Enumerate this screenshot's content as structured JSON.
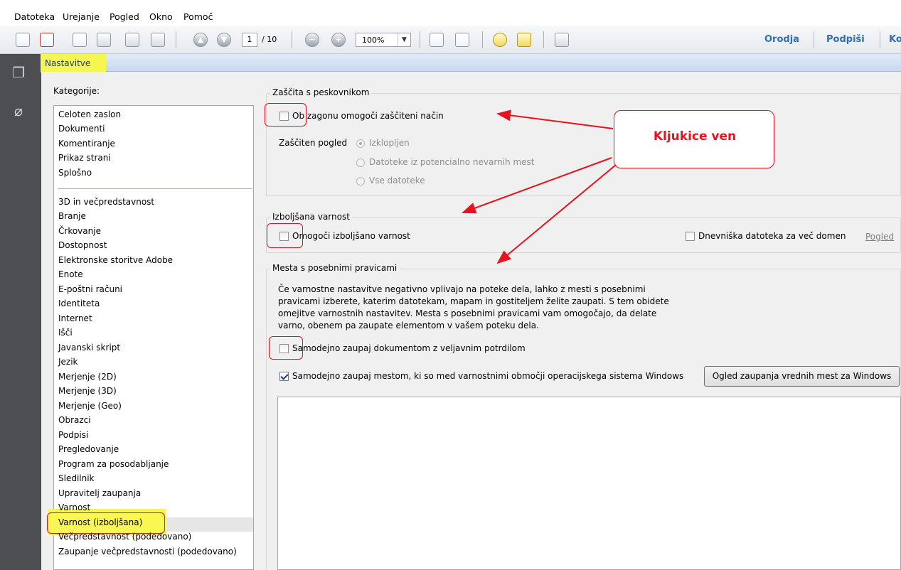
{
  "menu": [
    "Datoteka",
    "Urejanje",
    "Pogled",
    "Okno",
    "Pomoč"
  ],
  "toolbar": {
    "page_current": "1",
    "page_total": "/ 10",
    "zoom": "100%",
    "tools": "Orodja",
    "sign": "Podpiši",
    "comment_partial": "Ko"
  },
  "dialog": {
    "title": "Nastavitve",
    "categories_label": "Kategorije:",
    "categories_top": [
      "Celoten zaslon",
      "Dokumenti",
      "Komentiranje",
      "Prikaz strani",
      "Splošno"
    ],
    "categories": [
      "3D in večpredstavnost",
      "Branje",
      "Črkovanje",
      "Dostopnost",
      "Elektronske storitve Adobe",
      "Enote",
      "E-poštni računi",
      "Identiteta",
      "Internet",
      "Išči",
      "Javanski skript",
      "Jezik",
      "Merjenje (2D)",
      "Merjenje (3D)",
      "Merjenje (Geo)",
      "Obrazci",
      "Podpisi",
      "Pregledovanje",
      "Program za posodabljanje",
      "Sledilnik",
      "Upravitelj zaupanja",
      "Varnost",
      "Varnost (izboljšana)",
      "Večpredstavnost (podedovano)",
      "Zaupanje večpredstavnosti (podedovano)"
    ],
    "sandbox": {
      "title": "Zaščita s peskovnikom",
      "startup_checkbox": "Ob zagonu omogoči zaščiteni način",
      "protected_view_label": "Zaščiten pogled",
      "options": [
        "Izklopljen",
        "Datoteke iz potencialno nevarnih mest",
        "Vse datoteke"
      ]
    },
    "enhanced": {
      "title": "Izboljšana varnost",
      "enable_checkbox": "Omogoči izboljšano varnost",
      "crossdomain_checkbox": "Dnevniška datoteka za več domen",
      "view_link": "Pogled"
    },
    "privileged": {
      "title": "Mesta s posebnimi pravicami",
      "description": "Če varnostne nastavitve negativno vplivajo na poteke dela, lahko z mesti s posebnimi pravicami izberete, katerim datotekam, mapam in gostiteljem želite zaupati. S tem obidete omejitve varnostnih nastavitev. Mesta s posebnimi pravicami vam omogočajo, da delate varno, obenem pa zaupate elementom v vašem poteku dela.",
      "trust_cert_checkbox": "Samodejno zaupaj dokumentom z veljavnim potrdilom",
      "trust_windows_checkbox": "Samodejno zaupaj mestom, ki so med varnostnimi območji operacijskega sistema Windows",
      "windows_trust_button": "Ogled zaupanja vrednih mest za Windows"
    }
  },
  "annotation": {
    "callout": "Kljukice ven",
    "color": "#e8121c",
    "highlight_color": "#f9f751"
  }
}
